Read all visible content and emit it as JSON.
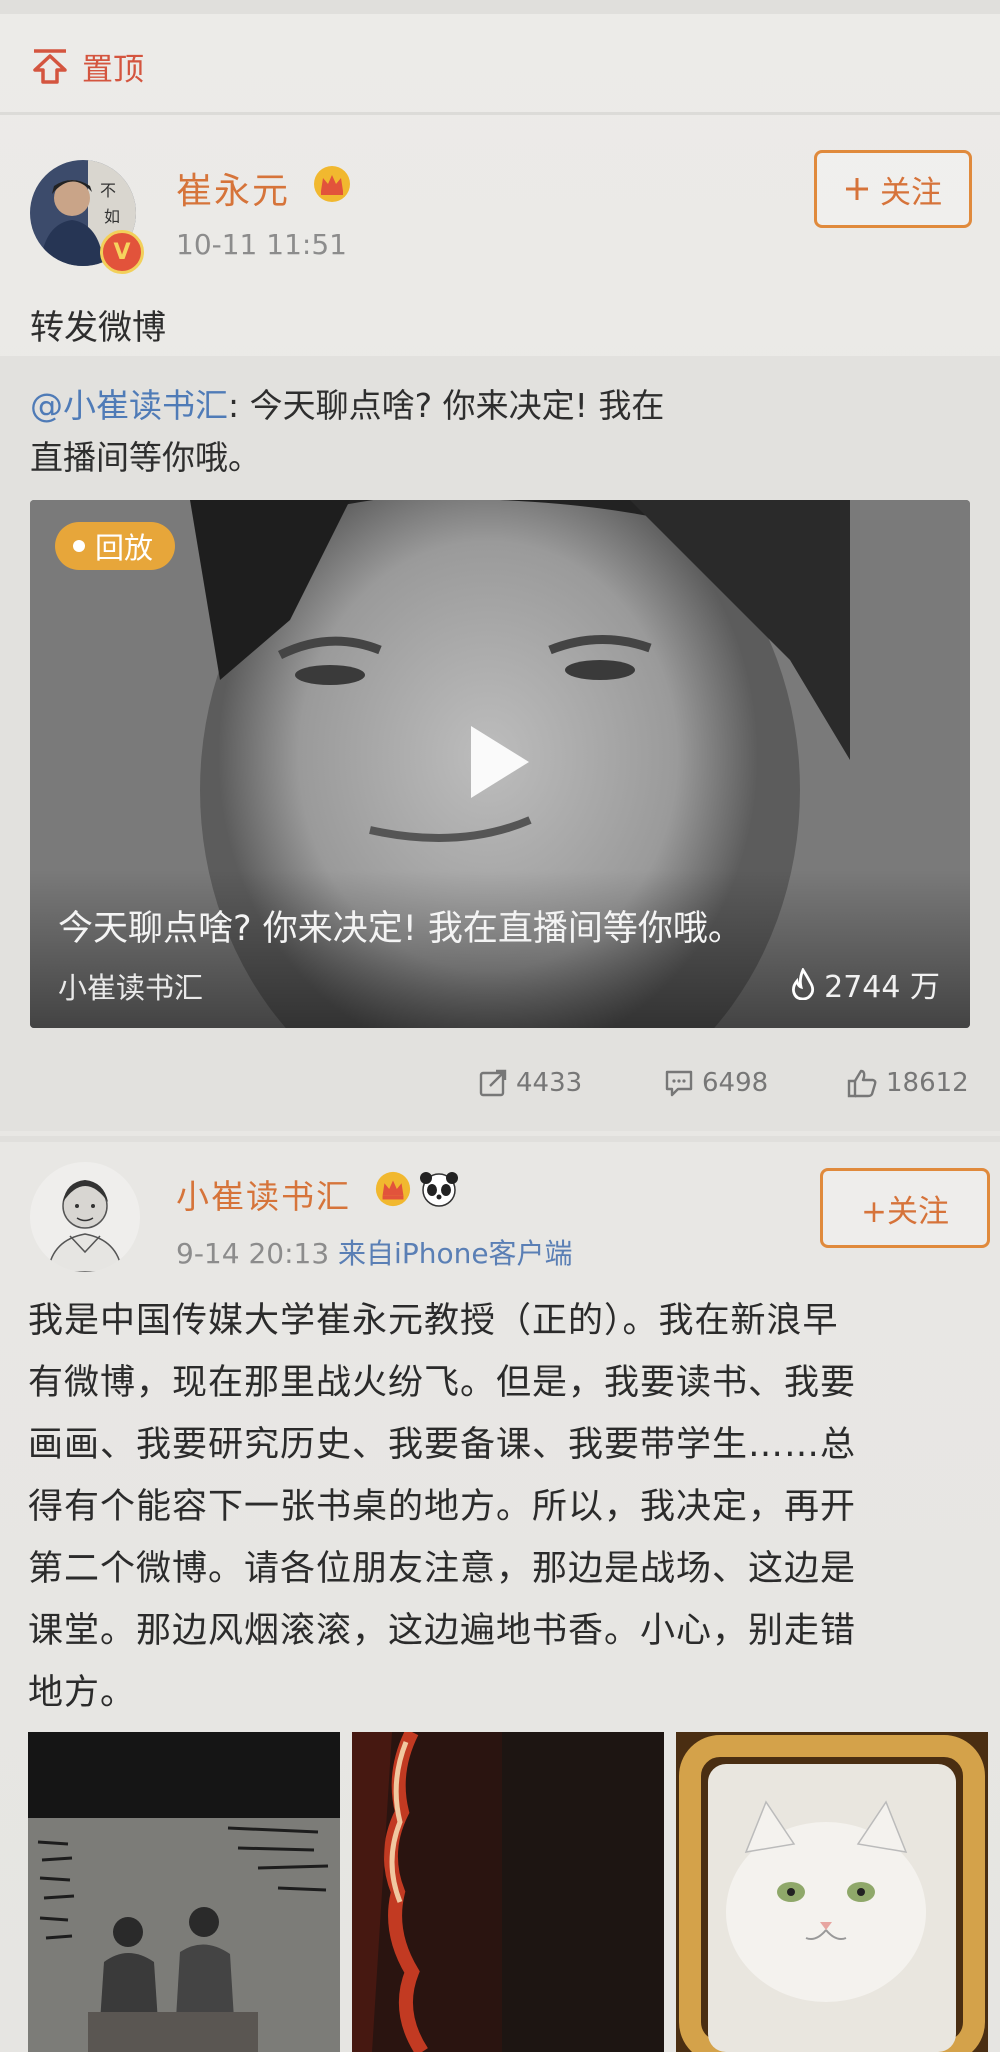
{
  "pinned": {
    "label": "置顶"
  },
  "post1": {
    "author": "崔永元",
    "time": "10-11 11:51",
    "follow_label": "关注",
    "text": "转发微博",
    "repost": {
      "mention": "@小崔读书汇",
      "text_line1": ": 今天聊点啥? 你来决定! 我在",
      "text_line2": "直播间等你哦。"
    },
    "video": {
      "badge": "回放",
      "title": "今天聊点啥? 你来决定! 我在直播间等你哦。",
      "source": "小崔读书汇",
      "views": "2744 万"
    },
    "actions": {
      "reposts": "4433",
      "comments": "6498",
      "likes": "18612"
    }
  },
  "post2": {
    "author": "小崔读书汇",
    "time": "9-14 20:13",
    "source": "来自iPhone客户端",
    "follow_label": "+关注",
    "lines": [
      "我是中国传媒大学崔永元教授（正的）。我在新浪早",
      "有微博，现在那里战火纷飞。但是，我要读书、我要",
      "画画、我要研究历史、我要备课、我要带学生……总",
      "得有个能容下一张书桌的地方。所以，我决定，再开",
      "第二个微博。请各位朋友注意，那边是战场、这边是",
      "课堂。那边风烟滚滚，这边遍地书香。小心，别走错",
      "地方。"
    ]
  },
  "colors": {
    "accent": "#d6743a",
    "link": "#4f7bb7",
    "badge": "#e7a63a"
  }
}
